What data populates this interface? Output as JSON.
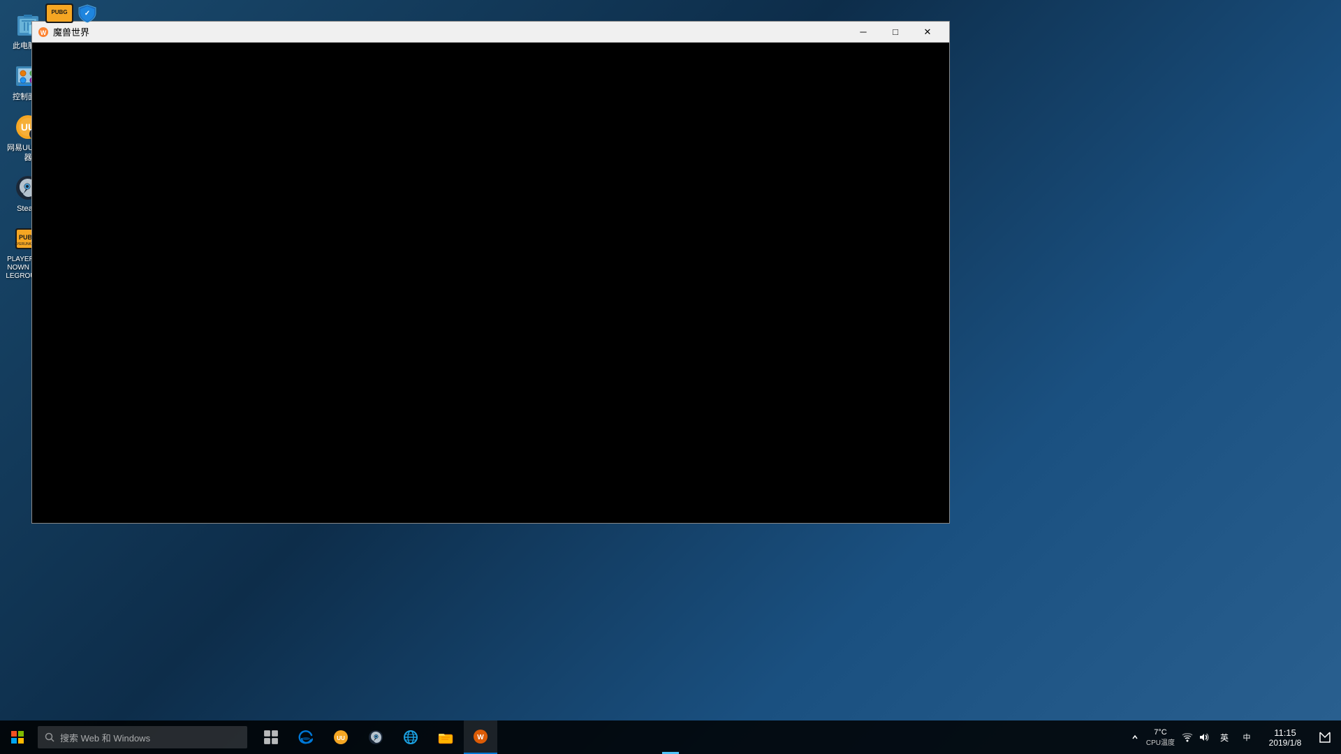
{
  "desktop": {
    "background_color": "#1a3a5c",
    "icons": [
      {
        "id": "recycle-bin",
        "label": "此电脑站",
        "icon_type": "recycle"
      },
      {
        "id": "control-panel",
        "label": "控制面板",
        "icon_type": "controlpanel"
      },
      {
        "id": "uu-accelerator",
        "label": "网易UU加速器",
        "icon_type": "uu"
      },
      {
        "id": "steam",
        "label": "Steam",
        "icon_type": "steam"
      },
      {
        "id": "pubg",
        "label": "PLAYERUNKNOWN BATTLEGROUNDS",
        "icon_type": "pubg"
      }
    ]
  },
  "window": {
    "title": "魔兽世界",
    "icon_type": "wow",
    "content": "black",
    "controls": {
      "minimize": "─",
      "maximize": "□",
      "close": "✕"
    }
  },
  "taskbar": {
    "search_placeholder": "搜索 Web 和 Windows",
    "clock": {
      "time": "11:15",
      "date": "2019/1/8"
    },
    "temperature": {
      "label": "7°C",
      "sublabel": "CPU温度"
    },
    "apps": [
      {
        "id": "task-view",
        "label": "任务视图"
      },
      {
        "id": "edge",
        "label": "Microsoft Edge"
      },
      {
        "id": "uu-tray",
        "label": "UU加速器"
      },
      {
        "id": "steam-tray",
        "label": "Steam"
      },
      {
        "id": "ie",
        "label": "Internet Explorer"
      },
      {
        "id": "file-explorer",
        "label": "文件资源管理器"
      },
      {
        "id": "wow-active",
        "label": "魔兽世界"
      }
    ]
  },
  "system_tray": {
    "chevron_label": "显示隐藏图标",
    "icons": [
      {
        "id": "network",
        "label": "网络"
      },
      {
        "id": "volume",
        "label": "音量"
      },
      {
        "id": "keyboard",
        "label": "输入法"
      },
      {
        "id": "lang",
        "label": "语言"
      }
    ],
    "notification": "通知中心"
  }
}
